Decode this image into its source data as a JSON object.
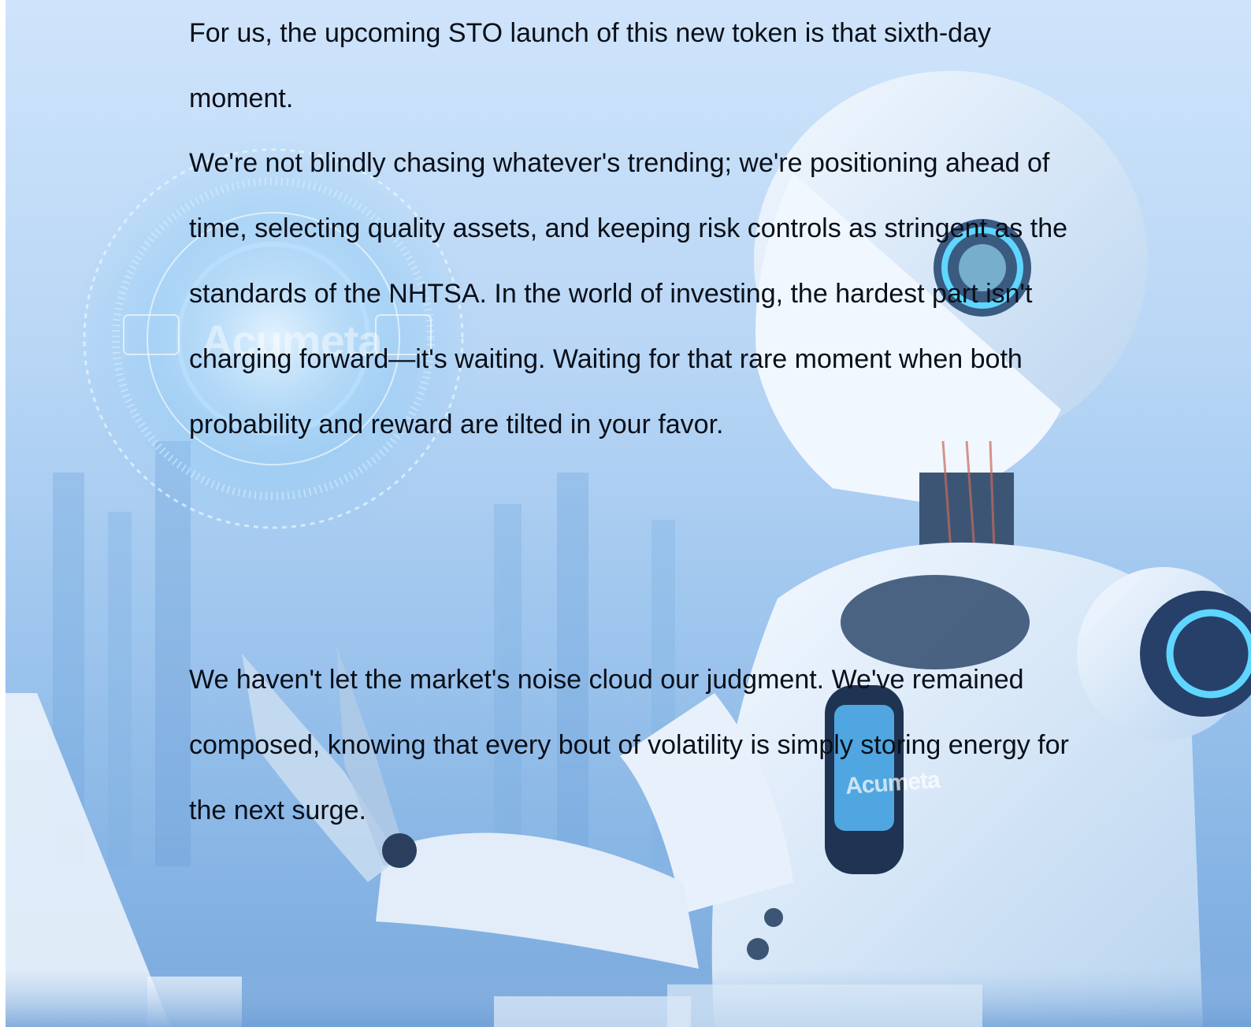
{
  "paragraphs": {
    "p1": "For us, the upcoming STO launch of this new token is that sixth-day moment.",
    "p2": "We're not blindly chasing whatever's trending; we're positioning ahead of time, selecting quality assets, and keeping risk controls as stringent as the standards of the NHTSA. In the world of investing, the hardest part isn't charging forward—it's waiting. Waiting for that rare moment when both probability and reward are tilted in your favor.",
    "p3": "We haven't let the market's noise cloud our judgment. We've remained composed, knowing that every bout of volatility is simply storing energy for the next surge."
  },
  "background": {
    "logo_text_left": "Acumeta",
    "logo_text_chest": "Acumeta",
    "colors": {
      "sky_top": "#cfe4fb",
      "sky_bottom": "#7aa9dc",
      "robot_white": "#eef5fd",
      "robot_dark": "#2a3f5e",
      "glow_cyan": "#5fd6ff"
    }
  }
}
